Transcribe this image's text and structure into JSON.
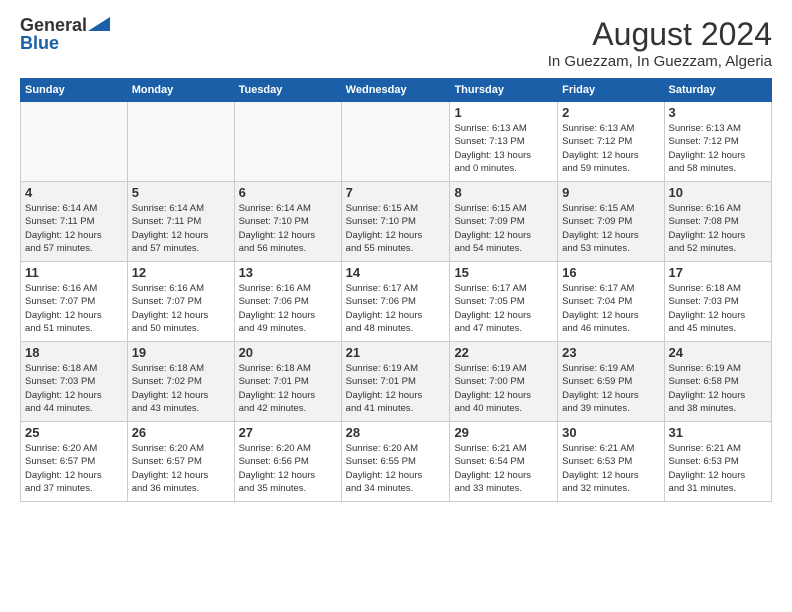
{
  "header": {
    "logo_general": "General",
    "logo_blue": "Blue",
    "title": "August 2024",
    "subtitle": "In Guezzam, In Guezzam, Algeria"
  },
  "days_of_week": [
    "Sunday",
    "Monday",
    "Tuesday",
    "Wednesday",
    "Thursday",
    "Friday",
    "Saturday"
  ],
  "weeks": [
    [
      {
        "day": "",
        "info": ""
      },
      {
        "day": "",
        "info": ""
      },
      {
        "day": "",
        "info": ""
      },
      {
        "day": "",
        "info": ""
      },
      {
        "day": "1",
        "info": "Sunrise: 6:13 AM\nSunset: 7:13 PM\nDaylight: 13 hours\nand 0 minutes."
      },
      {
        "day": "2",
        "info": "Sunrise: 6:13 AM\nSunset: 7:12 PM\nDaylight: 12 hours\nand 59 minutes."
      },
      {
        "day": "3",
        "info": "Sunrise: 6:13 AM\nSunset: 7:12 PM\nDaylight: 12 hours\nand 58 minutes."
      }
    ],
    [
      {
        "day": "4",
        "info": "Sunrise: 6:14 AM\nSunset: 7:11 PM\nDaylight: 12 hours\nand 57 minutes."
      },
      {
        "day": "5",
        "info": "Sunrise: 6:14 AM\nSunset: 7:11 PM\nDaylight: 12 hours\nand 57 minutes."
      },
      {
        "day": "6",
        "info": "Sunrise: 6:14 AM\nSunset: 7:10 PM\nDaylight: 12 hours\nand 56 minutes."
      },
      {
        "day": "7",
        "info": "Sunrise: 6:15 AM\nSunset: 7:10 PM\nDaylight: 12 hours\nand 55 minutes."
      },
      {
        "day": "8",
        "info": "Sunrise: 6:15 AM\nSunset: 7:09 PM\nDaylight: 12 hours\nand 54 minutes."
      },
      {
        "day": "9",
        "info": "Sunrise: 6:15 AM\nSunset: 7:09 PM\nDaylight: 12 hours\nand 53 minutes."
      },
      {
        "day": "10",
        "info": "Sunrise: 6:16 AM\nSunset: 7:08 PM\nDaylight: 12 hours\nand 52 minutes."
      }
    ],
    [
      {
        "day": "11",
        "info": "Sunrise: 6:16 AM\nSunset: 7:07 PM\nDaylight: 12 hours\nand 51 minutes."
      },
      {
        "day": "12",
        "info": "Sunrise: 6:16 AM\nSunset: 7:07 PM\nDaylight: 12 hours\nand 50 minutes."
      },
      {
        "day": "13",
        "info": "Sunrise: 6:16 AM\nSunset: 7:06 PM\nDaylight: 12 hours\nand 49 minutes."
      },
      {
        "day": "14",
        "info": "Sunrise: 6:17 AM\nSunset: 7:06 PM\nDaylight: 12 hours\nand 48 minutes."
      },
      {
        "day": "15",
        "info": "Sunrise: 6:17 AM\nSunset: 7:05 PM\nDaylight: 12 hours\nand 47 minutes."
      },
      {
        "day": "16",
        "info": "Sunrise: 6:17 AM\nSunset: 7:04 PM\nDaylight: 12 hours\nand 46 minutes."
      },
      {
        "day": "17",
        "info": "Sunrise: 6:18 AM\nSunset: 7:03 PM\nDaylight: 12 hours\nand 45 minutes."
      }
    ],
    [
      {
        "day": "18",
        "info": "Sunrise: 6:18 AM\nSunset: 7:03 PM\nDaylight: 12 hours\nand 44 minutes."
      },
      {
        "day": "19",
        "info": "Sunrise: 6:18 AM\nSunset: 7:02 PM\nDaylight: 12 hours\nand 43 minutes."
      },
      {
        "day": "20",
        "info": "Sunrise: 6:18 AM\nSunset: 7:01 PM\nDaylight: 12 hours\nand 42 minutes."
      },
      {
        "day": "21",
        "info": "Sunrise: 6:19 AM\nSunset: 7:01 PM\nDaylight: 12 hours\nand 41 minutes."
      },
      {
        "day": "22",
        "info": "Sunrise: 6:19 AM\nSunset: 7:00 PM\nDaylight: 12 hours\nand 40 minutes."
      },
      {
        "day": "23",
        "info": "Sunrise: 6:19 AM\nSunset: 6:59 PM\nDaylight: 12 hours\nand 39 minutes."
      },
      {
        "day": "24",
        "info": "Sunrise: 6:19 AM\nSunset: 6:58 PM\nDaylight: 12 hours\nand 38 minutes."
      }
    ],
    [
      {
        "day": "25",
        "info": "Sunrise: 6:20 AM\nSunset: 6:57 PM\nDaylight: 12 hours\nand 37 minutes."
      },
      {
        "day": "26",
        "info": "Sunrise: 6:20 AM\nSunset: 6:57 PM\nDaylight: 12 hours\nand 36 minutes."
      },
      {
        "day": "27",
        "info": "Sunrise: 6:20 AM\nSunset: 6:56 PM\nDaylight: 12 hours\nand 35 minutes."
      },
      {
        "day": "28",
        "info": "Sunrise: 6:20 AM\nSunset: 6:55 PM\nDaylight: 12 hours\nand 34 minutes."
      },
      {
        "day": "29",
        "info": "Sunrise: 6:21 AM\nSunset: 6:54 PM\nDaylight: 12 hours\nand 33 minutes."
      },
      {
        "day": "30",
        "info": "Sunrise: 6:21 AM\nSunset: 6:53 PM\nDaylight: 12 hours\nand 32 minutes."
      },
      {
        "day": "31",
        "info": "Sunrise: 6:21 AM\nSunset: 6:53 PM\nDaylight: 12 hours\nand 31 minutes."
      }
    ]
  ]
}
